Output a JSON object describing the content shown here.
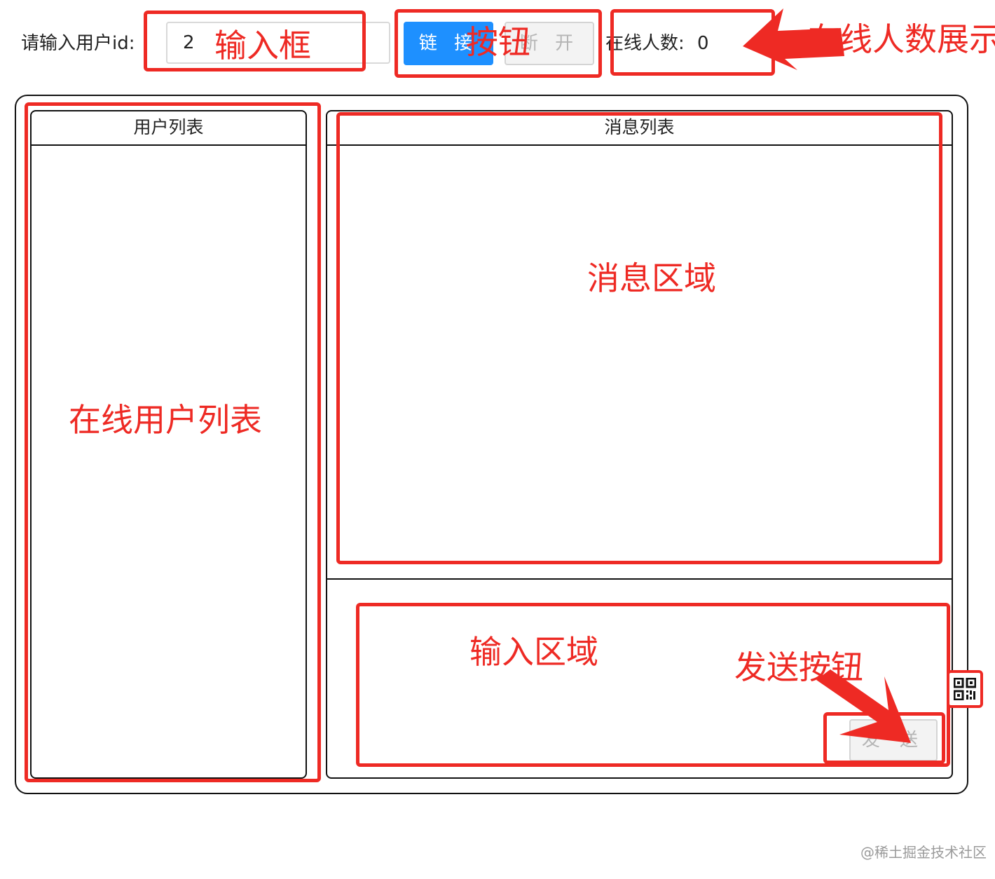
{
  "top_bar": {
    "uid_label": "请输入用户id:",
    "uid_value": "2",
    "connect_label": "链 接",
    "disconnect_label": "断 开",
    "online_label": "在线人数:",
    "online_count": "0"
  },
  "user_panel": {
    "title": "用户列表"
  },
  "message_panel": {
    "title": "消息列表",
    "send_label": "发 送"
  },
  "annotations": {
    "input_box": "输入框",
    "button": "按钮",
    "online_count_display": "在线人数展示",
    "online_user_list": "在线用户列表",
    "message_area": "消息区域",
    "input_area": "输入区域",
    "send_button": "发送按钮"
  },
  "watermark": "@稀土掘金技术社区",
  "colors": {
    "accent": "#1e90ff",
    "annotation": "#ee2a24"
  },
  "icons": {
    "qr": "qr-code-icon"
  }
}
